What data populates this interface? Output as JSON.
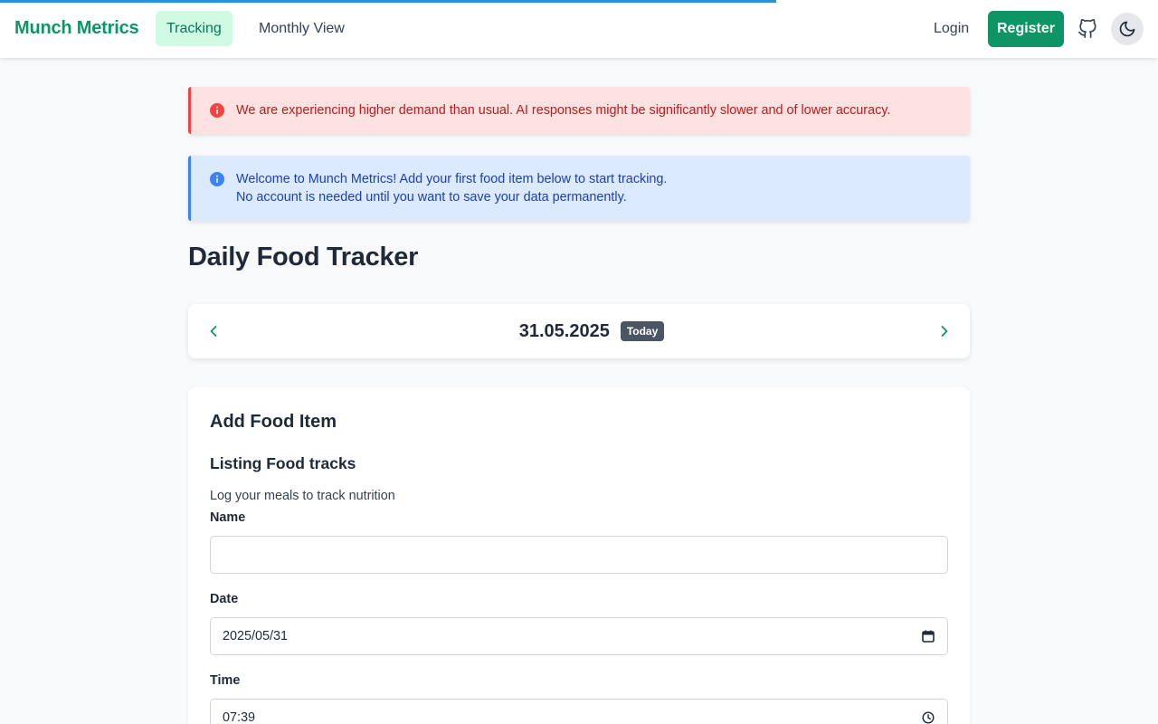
{
  "colors": {
    "brand": "#0e9566",
    "progress": "#2c8fd8",
    "warning_bg": "#fee2e2",
    "warning_border": "#ef4444",
    "info_bg": "#dbeafe",
    "info_border": "#3b82f6",
    "badge_bg": "#4b5563"
  },
  "nav": {
    "brand": "Munch Metrics",
    "tabs": [
      {
        "label": "Tracking",
        "active": true
      },
      {
        "label": "Monthly View",
        "active": false
      }
    ],
    "login": "Login",
    "register": "Register",
    "icons": {
      "github": "github-icon",
      "theme": "moon-icon"
    }
  },
  "loading_progress": 0.67,
  "alerts": {
    "warning": {
      "icon": "info-circle-icon",
      "text": "We are experiencing higher demand than usual. AI responses might be significantly slower and of lower accuracy."
    },
    "info": {
      "icon": "info-circle-icon",
      "line1": "Welcome to Munch Metrics! Add your first food item below to start tracking.",
      "line2": "No account is needed until you want to save your data permanently."
    }
  },
  "page": {
    "title": "Daily Food Tracker"
  },
  "date_nav": {
    "date": "31.05.2025",
    "badge": "Today",
    "prev_icon": "chevron-left-icon",
    "next_icon": "chevron-right-icon"
  },
  "form": {
    "title": "Add Food Item",
    "subtitle": "Listing Food tracks",
    "description": "Log your meals to track nutrition",
    "fields": {
      "name": {
        "label": "Name",
        "value": ""
      },
      "date": {
        "label": "Date",
        "value": "2025/05/31",
        "icon": "calendar-icon"
      },
      "time": {
        "label": "Time",
        "value": "07:39",
        "icon": "clock-icon"
      }
    }
  }
}
